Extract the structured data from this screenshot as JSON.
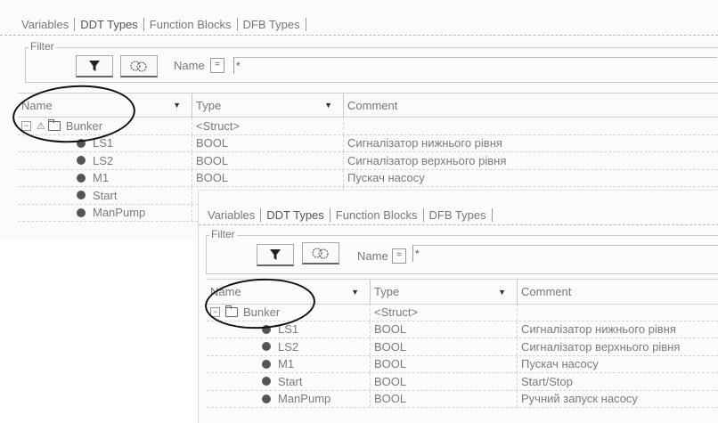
{
  "back": {
    "tabs": [
      "Variables",
      "DDT Types",
      "Function Blocks",
      "DFB Types"
    ],
    "filter_label": "Filter",
    "name_label": "Name",
    "operator": "=",
    "filter_value": "*",
    "columns": [
      "Name",
      "Type",
      "Comment"
    ],
    "group": {
      "name": "Bunker",
      "type": "<Struct>"
    },
    "rows": [
      {
        "name": "LS1",
        "type": "BOOL",
        "comment": "Сигналізатор нижнього рівня"
      },
      {
        "name": "LS2",
        "type": "BOOL",
        "comment": "Сигналізатор верхнього рівня"
      },
      {
        "name": "M1",
        "type": "BOOL",
        "comment": "Пускач насосу"
      },
      {
        "name": "Start",
        "type": "",
        "comment": ""
      },
      {
        "name": "ManPump",
        "type": "",
        "comment": ""
      }
    ]
  },
  "front": {
    "tabs": [
      "Variables",
      "DDT Types",
      "Function Blocks",
      "DFB Types"
    ],
    "filter_label": "Filter",
    "name_label": "Name",
    "operator": "=",
    "filter_value": "*",
    "columns": [
      "Name",
      "Type",
      "Comment"
    ],
    "group": {
      "name": "Bunker",
      "type": "<Struct>"
    },
    "rows": [
      {
        "name": "LS1",
        "type": "BOOL",
        "comment": "Сигналізатор нижнього рівня"
      },
      {
        "name": "LS2",
        "type": "BOOL",
        "comment": "Сигналізатор верхнього рівня"
      },
      {
        "name": "M1",
        "type": "BOOL",
        "comment": "Пускач насосу"
      },
      {
        "name": "Start",
        "type": "BOOL",
        "comment": "Start/Stop"
      },
      {
        "name": "ManPump",
        "type": "BOOL",
        "comment": "Ручний запуск насосу"
      }
    ]
  },
  "icons": {
    "filter": "funnel-icon",
    "dtype": "datatype-filter-icon",
    "element": "element-dot-icon",
    "struct": "struct-folder-icon"
  }
}
